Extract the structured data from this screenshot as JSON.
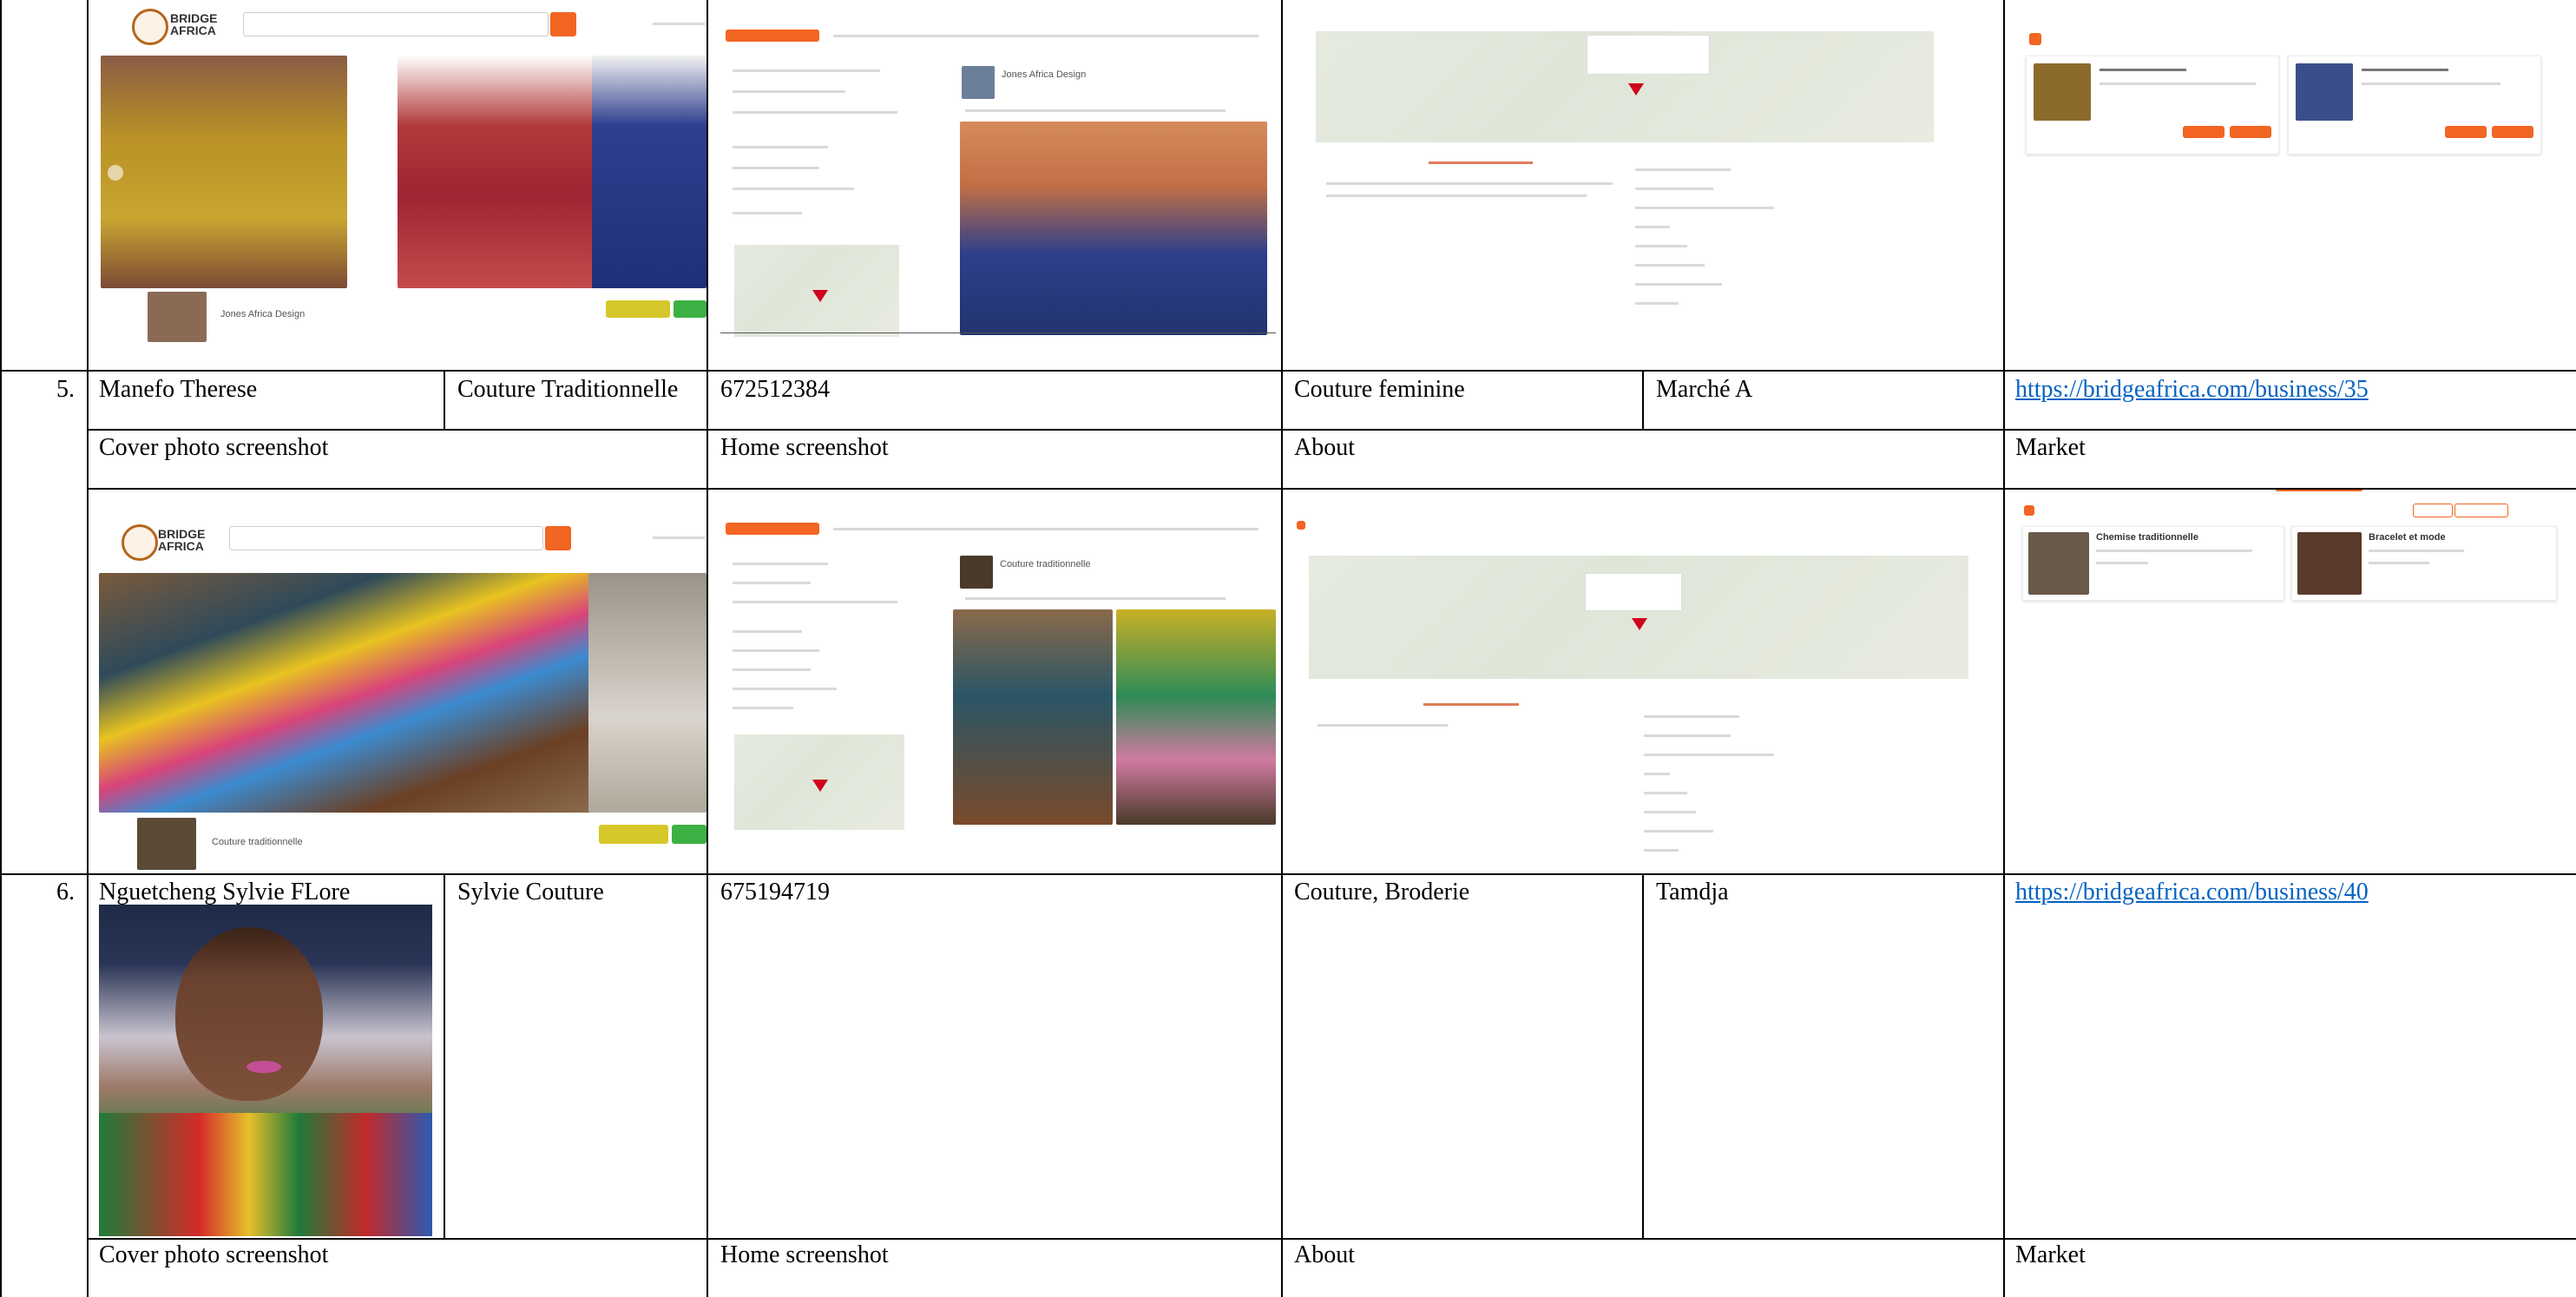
{
  "rows": [
    {
      "number": "5.",
      "owner": "Manefo Therese",
      "business": "Couture Traditionnelle",
      "phone": "672512384",
      "activity": "Couture feminine",
      "location": "Marché A",
      "url": "https://bridgeafrica.com/business/35"
    },
    {
      "number": "6.",
      "owner": "Nguetcheng Sylvie FLore",
      "business": "Sylvie Couture",
      "phone": "675194719",
      "activity": "Couture, Broderie",
      "location": "Tamdja",
      "url": "https://bridgeafrica.com/business/40"
    }
  ],
  "section_labels": {
    "cover": "Cover photo screenshot",
    "home": "Home screenshot",
    "about": "About",
    "market": "Market"
  },
  "screens": {
    "brand": "BRIDGE AFRICA",
    "row4": {
      "cover_name": "Jones Africa Design",
      "home_name": "Jones Africa Design"
    },
    "row5": {
      "cover_name": "Couture traditionnelle",
      "home_name": "Couture traditionnelle",
      "product_1": "Chemise traditionnelle",
      "product_2": "Bracelet et mode"
    }
  },
  "colors": {
    "accent": "#f26522",
    "link": "#0563c1",
    "tag_yellow": "#d6c72a",
    "tag_green": "#3cb043"
  }
}
